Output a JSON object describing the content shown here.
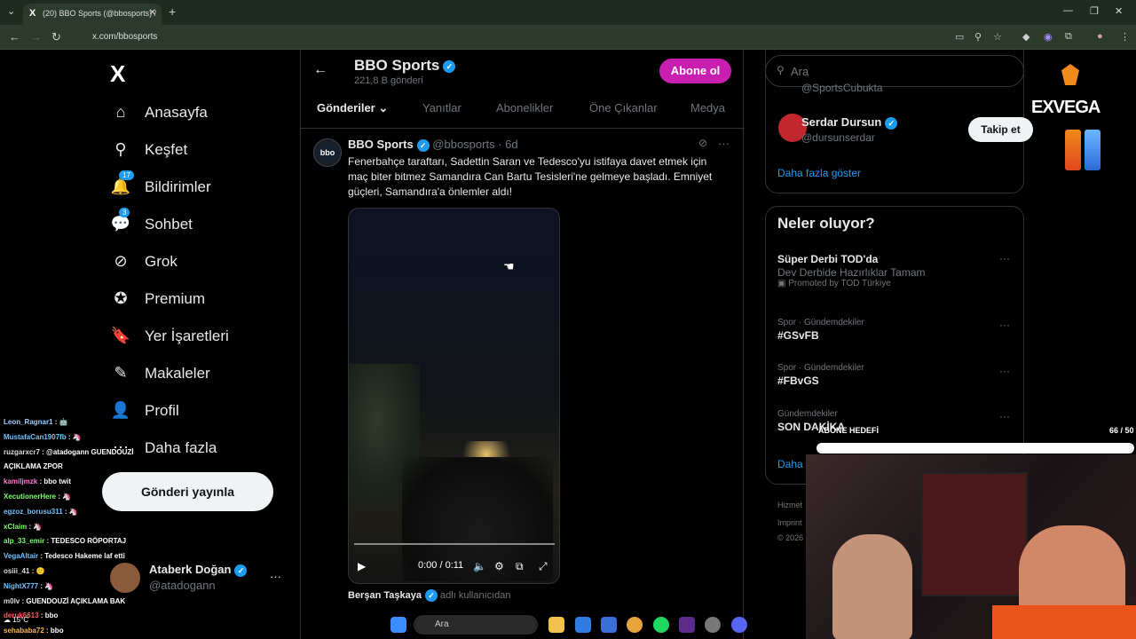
{
  "browser": {
    "tab_title": "(20) BBO Sports (@bbosports) /",
    "url": "x.com/bbosports",
    "x_icon": "X",
    "close_icon": "✕",
    "new_tab": "+"
  },
  "sidebar": {
    "logo": "X",
    "items": [
      {
        "label": "Anasayfa",
        "icon": "home-icon",
        "glyph": "⌂"
      },
      {
        "label": "Keşfet",
        "icon": "search-icon",
        "glyph": "⚲"
      },
      {
        "label": "Bildirimler",
        "icon": "bell-icon",
        "glyph": "🔔",
        "badge": "17"
      },
      {
        "label": "Sohbet",
        "icon": "chat-icon",
        "glyph": "💬",
        "badge": "3"
      },
      {
        "label": "Grok",
        "icon": "grok-icon",
        "glyph": "⊘"
      },
      {
        "label": "Premium",
        "icon": "premium-icon",
        "glyph": "✪"
      },
      {
        "label": "Yer İşaretleri",
        "icon": "bookmark-icon",
        "glyph": "🔖"
      },
      {
        "label": "Makaleler",
        "icon": "article-icon",
        "glyph": "✎"
      },
      {
        "label": "Profil",
        "icon": "profile-icon",
        "glyph": "👤"
      },
      {
        "label": "Daha fazla",
        "icon": "more-icon",
        "glyph": "⋯"
      }
    ],
    "post_button": "Gönderi yayınla",
    "account": {
      "name": "Ataberk Doğan",
      "handle": "@atadogann",
      "more": "···"
    }
  },
  "chat": {
    "messages": [
      {
        "user": "Leon_Ragnar1",
        "text": "🤖",
        "color": "#9ad0ff"
      },
      {
        "user": "MustafaCan1907fb",
        "text": "🦄",
        "color": "#6fc2ff"
      },
      {
        "user": "ruzgarxcr7",
        "text": "@atadogann GUENDOUZİ AÇIKLAMA ZPOR",
        "color": "#dddddd"
      },
      {
        "user": "kamiljmzk",
        "text": "bbo twit",
        "color": "#ff7bd4"
      },
      {
        "user": "XecutionerHere",
        "text": "🦄",
        "color": "#7cff6b"
      },
      {
        "user": "egzoz_borusu311",
        "text": "🦄",
        "color": "#6fc2ff"
      },
      {
        "user": "xClaim",
        "text": "🦄",
        "color": "#7cff6b"
      },
      {
        "user": "alp_33_emir",
        "text": "TEDESCO RÖPORTAJ",
        "color": "#7cff6b"
      },
      {
        "user": "VegaAltair",
        "text": "Tedesco Hakeme laf etti",
        "color": "#6fc2ff"
      },
      {
        "user": "osiii_41",
        "text": "🙂",
        "color": "#dddddd"
      },
      {
        "user": "NightX777",
        "text": "🦄",
        "color": "#6fc2ff"
      },
      {
        "user": "m0lv",
        "text": "GUENDOUZİ AÇIKLAMA BAK",
        "color": "#dddddd"
      },
      {
        "user": "deruk6613",
        "text": "bbo",
        "color": "#ff5b5b"
      },
      {
        "user": "sehababa72",
        "text": "bbo",
        "color": "#ffb84d"
      }
    ]
  },
  "profile": {
    "name": "BBO Sports",
    "posts_count": "221,8 B gönderi",
    "subscribe": "Abone ol",
    "back": "←",
    "tabs": [
      "Gönderiler ⌄",
      "Yanıtlar",
      "Abonelikler",
      "Öne Çıkanlar",
      "Medya"
    ]
  },
  "tweet": {
    "avatar_text": "bbo",
    "author": "BBO Sports",
    "handle_time": "@bbosports · 6d",
    "text": "Fenerbahçe taraftarı, Sadettin Saran ve Tedesco'yu istifaya davet etmek için maç biter bitmez Samandıra Can Bartu Tesisleri'ne gelmeye başladı. Emniyet güçleri, Samandıra'a önlemler aldı!",
    "more": "···",
    "grok": "⊘",
    "video": {
      "time": "0:00 / 0:11",
      "progress": 0
    },
    "reply_author": "Berşan Taşkaya",
    "reply_sub": "adlı kullanıcıdan"
  },
  "right": {
    "search_placeholder": "Ara",
    "partial_handle": "@SportsCubukta",
    "follow": {
      "name": "Serdar Dursun",
      "handle": "@dursunserdar",
      "button": "Takip et"
    },
    "show_more": "Daha fazla göster",
    "trends_title": "Neler oluyor?",
    "trends": [
      {
        "meta": "",
        "name": "Süper Derbi TOD'da",
        "desc": "Dev Derbide Hazırlıklar Tamam",
        "promo": "Promoted by TOD Türkiye"
      },
      {
        "meta": "Spor · Gündemdekiler",
        "name": "#GSvFB"
      },
      {
        "meta": "Spor · Gündemdekiler",
        "name": "#FBvGS"
      },
      {
        "meta": "Gündemdekiler",
        "name": "SON DAKİKA"
      }
    ],
    "more_link": "Daha",
    "footer": [
      "Hizmet",
      "Imprint",
      "© 2026"
    ]
  },
  "overlay": {
    "brand": "EXVEGA",
    "goal_label": "ABONE HEDEFİ",
    "goal_count": "66 / 50",
    "goal_fraction": 1.0
  },
  "taskbar": {
    "search": "Ara",
    "weather": "15°C"
  }
}
